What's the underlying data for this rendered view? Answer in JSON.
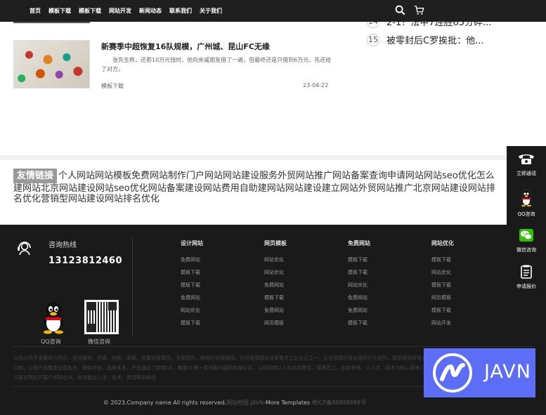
{
  "nav": {
    "items": [
      "首页",
      "模板下载",
      "模板下载",
      "网站开发",
      "新闻动态",
      "联系我们",
      "关于我们"
    ]
  },
  "article": {
    "title": "新赛季中超恢复16队规模，广州城、昆山FC无缘",
    "desc": "张先生称，还那10万元钱时，他向亲戚朋友借了一遍，但最终还是只借到6万元，先还给了对方。",
    "category": "模板下载",
    "date": "23-04-22"
  },
  "ranking": [
    {
      "num": "14",
      "text": "2-1！法甲7连胜65分碎..."
    },
    {
      "num": "15",
      "text": "被零封后C罗挨批：他..."
    }
  ],
  "links": {
    "title": "友情链接",
    "text": "个人网站网站模板免费网站制作门户网站网站建设服务外贸网站推广网站备案查询申请网站网站seo优化怎么建网站北京网站建设网站seo优化网站备案建设网站费用自助建网站网站建设建立网站外贸网站推广北京网站建设网站排名优化营销型网站建设网站排名优化"
  },
  "footer": {
    "hotline_label": "咨询热线",
    "hotline_number": "13123812460",
    "qq_label": "QQ咨询",
    "wechat_label": "微信咨询",
    "columns": [
      {
        "title": "设计网站",
        "items": [
          "免费网站",
          "模板下载",
          "模板下载",
          "免费网站",
          "网站优化",
          "模板下载"
        ]
      },
      {
        "title": "网页模板",
        "items": [
          "网站优化",
          "网站优化",
          "免费网站",
          "模板下载",
          "免费网站",
          "网页模板"
        ]
      },
      {
        "title": "免费网站",
        "items": [
          "模板下载",
          "模板下载",
          "网站优化",
          "免费网站",
          "免费网站",
          "模板下载"
        ]
      },
      {
        "title": "网站优化",
        "items": [
          "模板下载",
          "网站优化",
          "模板下载",
          "网页模板",
          "模板下载",
          "网站开发"
        ]
      }
    ],
    "about_text": "公司以科学发展观为指引，坚持诚信、拼搏、创新、奉献，共赢经营理念，全面提升，精细化管理强国。公司是福建省自家重点工业企业之一，企业规模位居全国同行业前列，国家级高新技术企业，创建国家级企业技术中心，享有自营进出口权。公司产品覆盖全国各大、规格齐全、品种多多，产品通过了欧盟CE、美国UL等一系列国内国际权威认证。公司坚持以人为本的理念，尊重员工，创新思维，以人才、技术为核心竞争力的基础，不断加强与国内外知名企业的合作，通过与著名院校开展产学研合作，有效整合人才、技术、市场等多种资",
    "copyright": "© 2023.Company name All rights reserved.",
    "sitemap": "网站地图",
    "brand": "JAVN",
    "more": "-More Templates",
    "icp": "粤ICP备88888888号"
  },
  "sidebar": {
    "items": [
      "立即通话",
      "QQ咨询",
      "微信咨询",
      "申请报价"
    ]
  },
  "watermark": {
    "text": "JAVN"
  }
}
